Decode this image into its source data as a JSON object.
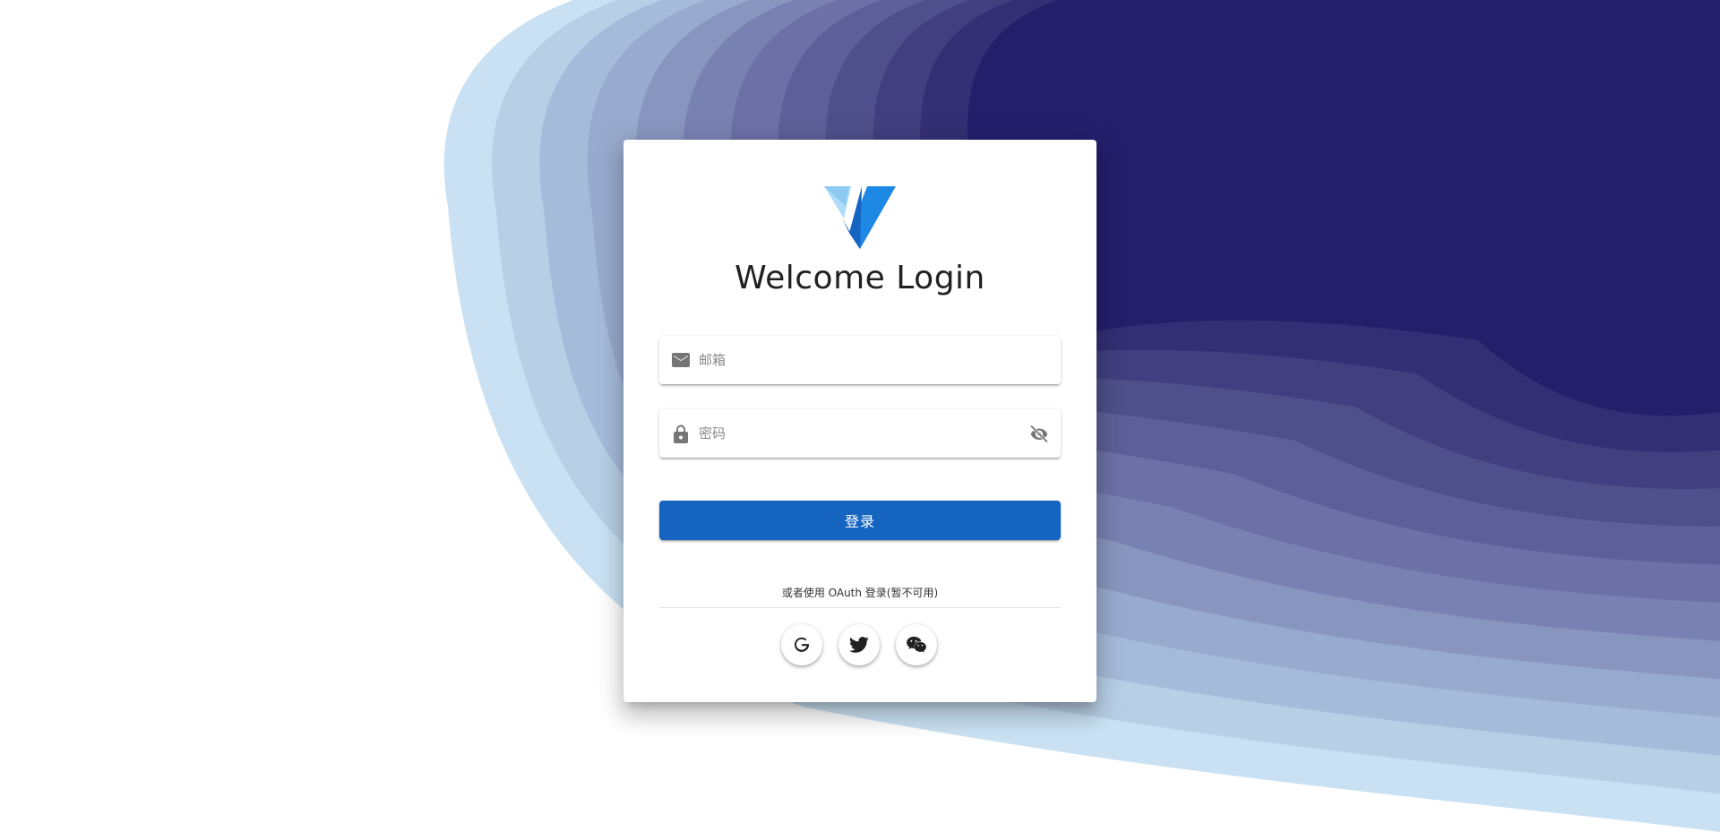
{
  "login": {
    "title": "Welcome Login",
    "email_placeholder": "邮箱",
    "password_placeholder": "密码",
    "login_button": "登录",
    "oauth_text": "或者使用 OAuth 登录(暂不可用)"
  },
  "oauth": [
    "google",
    "twitter",
    "wechat"
  ],
  "icons": {
    "email": "mail-icon",
    "password": "lock-icon",
    "toggle_visibility": "eye-off-icon"
  },
  "colors": {
    "primary": "#1565c0",
    "background_dark": "#241f6b",
    "background_light": "#c9e1f2"
  }
}
